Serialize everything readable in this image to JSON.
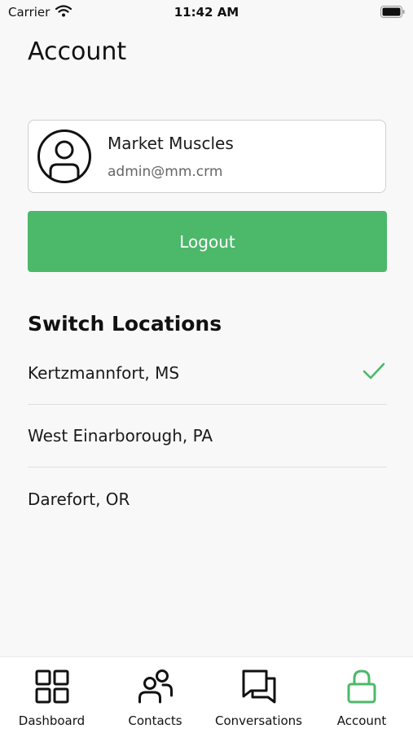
{
  "status_bar": {
    "carrier": "Carrier",
    "time": "11:42 AM"
  },
  "page": {
    "title": "Account"
  },
  "profile": {
    "name": "Market Muscles",
    "email": "admin@mm.crm"
  },
  "logout_label": "Logout",
  "locations": {
    "title": "Switch Locations",
    "items": [
      {
        "label": "Kertzmannfort, MS",
        "selected": true
      },
      {
        "label": "West Einarborough, PA",
        "selected": false
      },
      {
        "label": "Darefort, OR",
        "selected": false
      }
    ]
  },
  "tabs": [
    {
      "label": "Dashboard",
      "icon": "grid-icon",
      "active": false
    },
    {
      "label": "Contacts",
      "icon": "users-icon",
      "active": false
    },
    {
      "label": "Conversations",
      "icon": "chat-icon",
      "active": false
    },
    {
      "label": "Account",
      "icon": "lock-icon",
      "active": true
    }
  ],
  "colors": {
    "accent": "#4cb86a",
    "text": "#1a1a1a",
    "background": "#f8f8f8"
  }
}
